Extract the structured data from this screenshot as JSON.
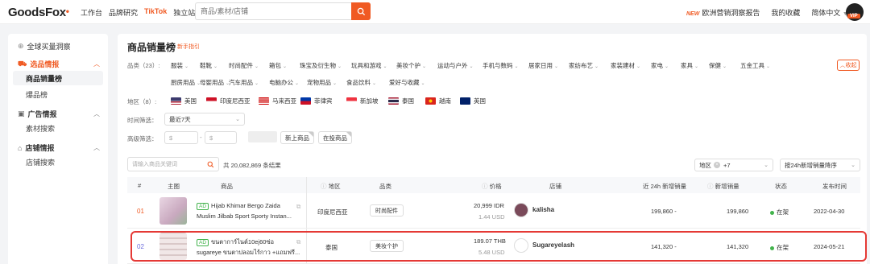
{
  "topnav": {
    "logo": "GoodsFox",
    "links": [
      "工作台",
      "品牌研究",
      "TikTok",
      "独立站"
    ],
    "search_placeholder": "商品/素材/店铺",
    "new_badge": "NEW",
    "report": "欧洲营销洞察报告",
    "favorites": "我的收藏",
    "language": "简体中文",
    "vip": "VIP"
  },
  "sidebar": {
    "insight": "全球买量洞察",
    "sections": [
      {
        "title": "选品情报",
        "items": [
          "商品销量榜",
          "爆品榜"
        ]
      },
      {
        "title": "广告情报",
        "items": [
          "素材搜索"
        ]
      },
      {
        "title": "店铺情报",
        "items": [
          "店铺搜索"
        ]
      }
    ]
  },
  "main": {
    "title": "商品销量榜",
    "guide": "新手指引",
    "category_label": "品类（23）:",
    "categories_row1": [
      "服装",
      "鞋靴",
      "时尚配件",
      "箱包",
      "珠宝及衍生物",
      "玩具和游戏",
      "美妆个护",
      "运动与户外",
      "手机与数码",
      "居家日用",
      "家纺布艺",
      "家装建材",
      "家电",
      "家具",
      "保健",
      "五金工具"
    ],
    "categories_row2": [
      "厨房用品",
      "母婴用品",
      "汽车用品",
      "电脑办公",
      "宠物用品",
      "食品饮料",
      "爱好与收藏"
    ],
    "collapse": "收起",
    "region_label": "地区（8）:",
    "regions": [
      "美国",
      "印度尼西亚",
      "马来西亚",
      "菲律宾",
      "新加坡",
      "泰国",
      "越南",
      "英国"
    ],
    "time_label": "时间筛选：",
    "time_value": "最近7天",
    "advanced_label": "高级筛选：",
    "price_symbol_a": "$",
    "price_dash": "-",
    "price_symbol_b": "$",
    "chip_new": "新上商品",
    "chip_live": "在投商品",
    "keyword_placeholder": "请输入商品关键词",
    "total": "共 20,082,869 条结果",
    "region_filter": "地区",
    "region_filter_count": "+7",
    "sort": "按24h新增销量降序"
  },
  "table": {
    "headers": [
      "#",
      "主图",
      "商品",
      "地区",
      "品类",
      "价格",
      "店铺",
      "近 24h 新增销量",
      "新增销量",
      "状态",
      "发布时间"
    ],
    "rows": [
      {
        "rank": "01",
        "ad": "AD",
        "title1": "Hijab Khimar Bergo Zaida",
        "title2": "Muslim Jilbab Sport Sporty Instan...",
        "region": "印度尼西亚",
        "category": "时尚配件",
        "price": "20,999 IDR",
        "price_usd": "1.44 USD",
        "store": "kalisha",
        "sales24h": "199,860",
        "sales_new": "199,860",
        "status": "在架",
        "date": "2022-04-30"
      },
      {
        "rank": "02",
        "ad": "AD",
        "title1": "ขนตาการ์ไนต์10ej60ซ่อ",
        "title2": "sugareye ขนตาปลอมไร้กาว +แถมฟรี...",
        "region": "泰国",
        "category": "美妆个护",
        "price": "189.07 THB",
        "price_usd": "5.48 USD",
        "store": "Sugareyelash",
        "sales24h": "141,320",
        "sales_new": "141,320",
        "status": "在架",
        "date": "2024-05-21"
      }
    ]
  },
  "colors": {
    "accent": "#f05a23",
    "success": "#42b34c",
    "highlight": "#e53935"
  }
}
